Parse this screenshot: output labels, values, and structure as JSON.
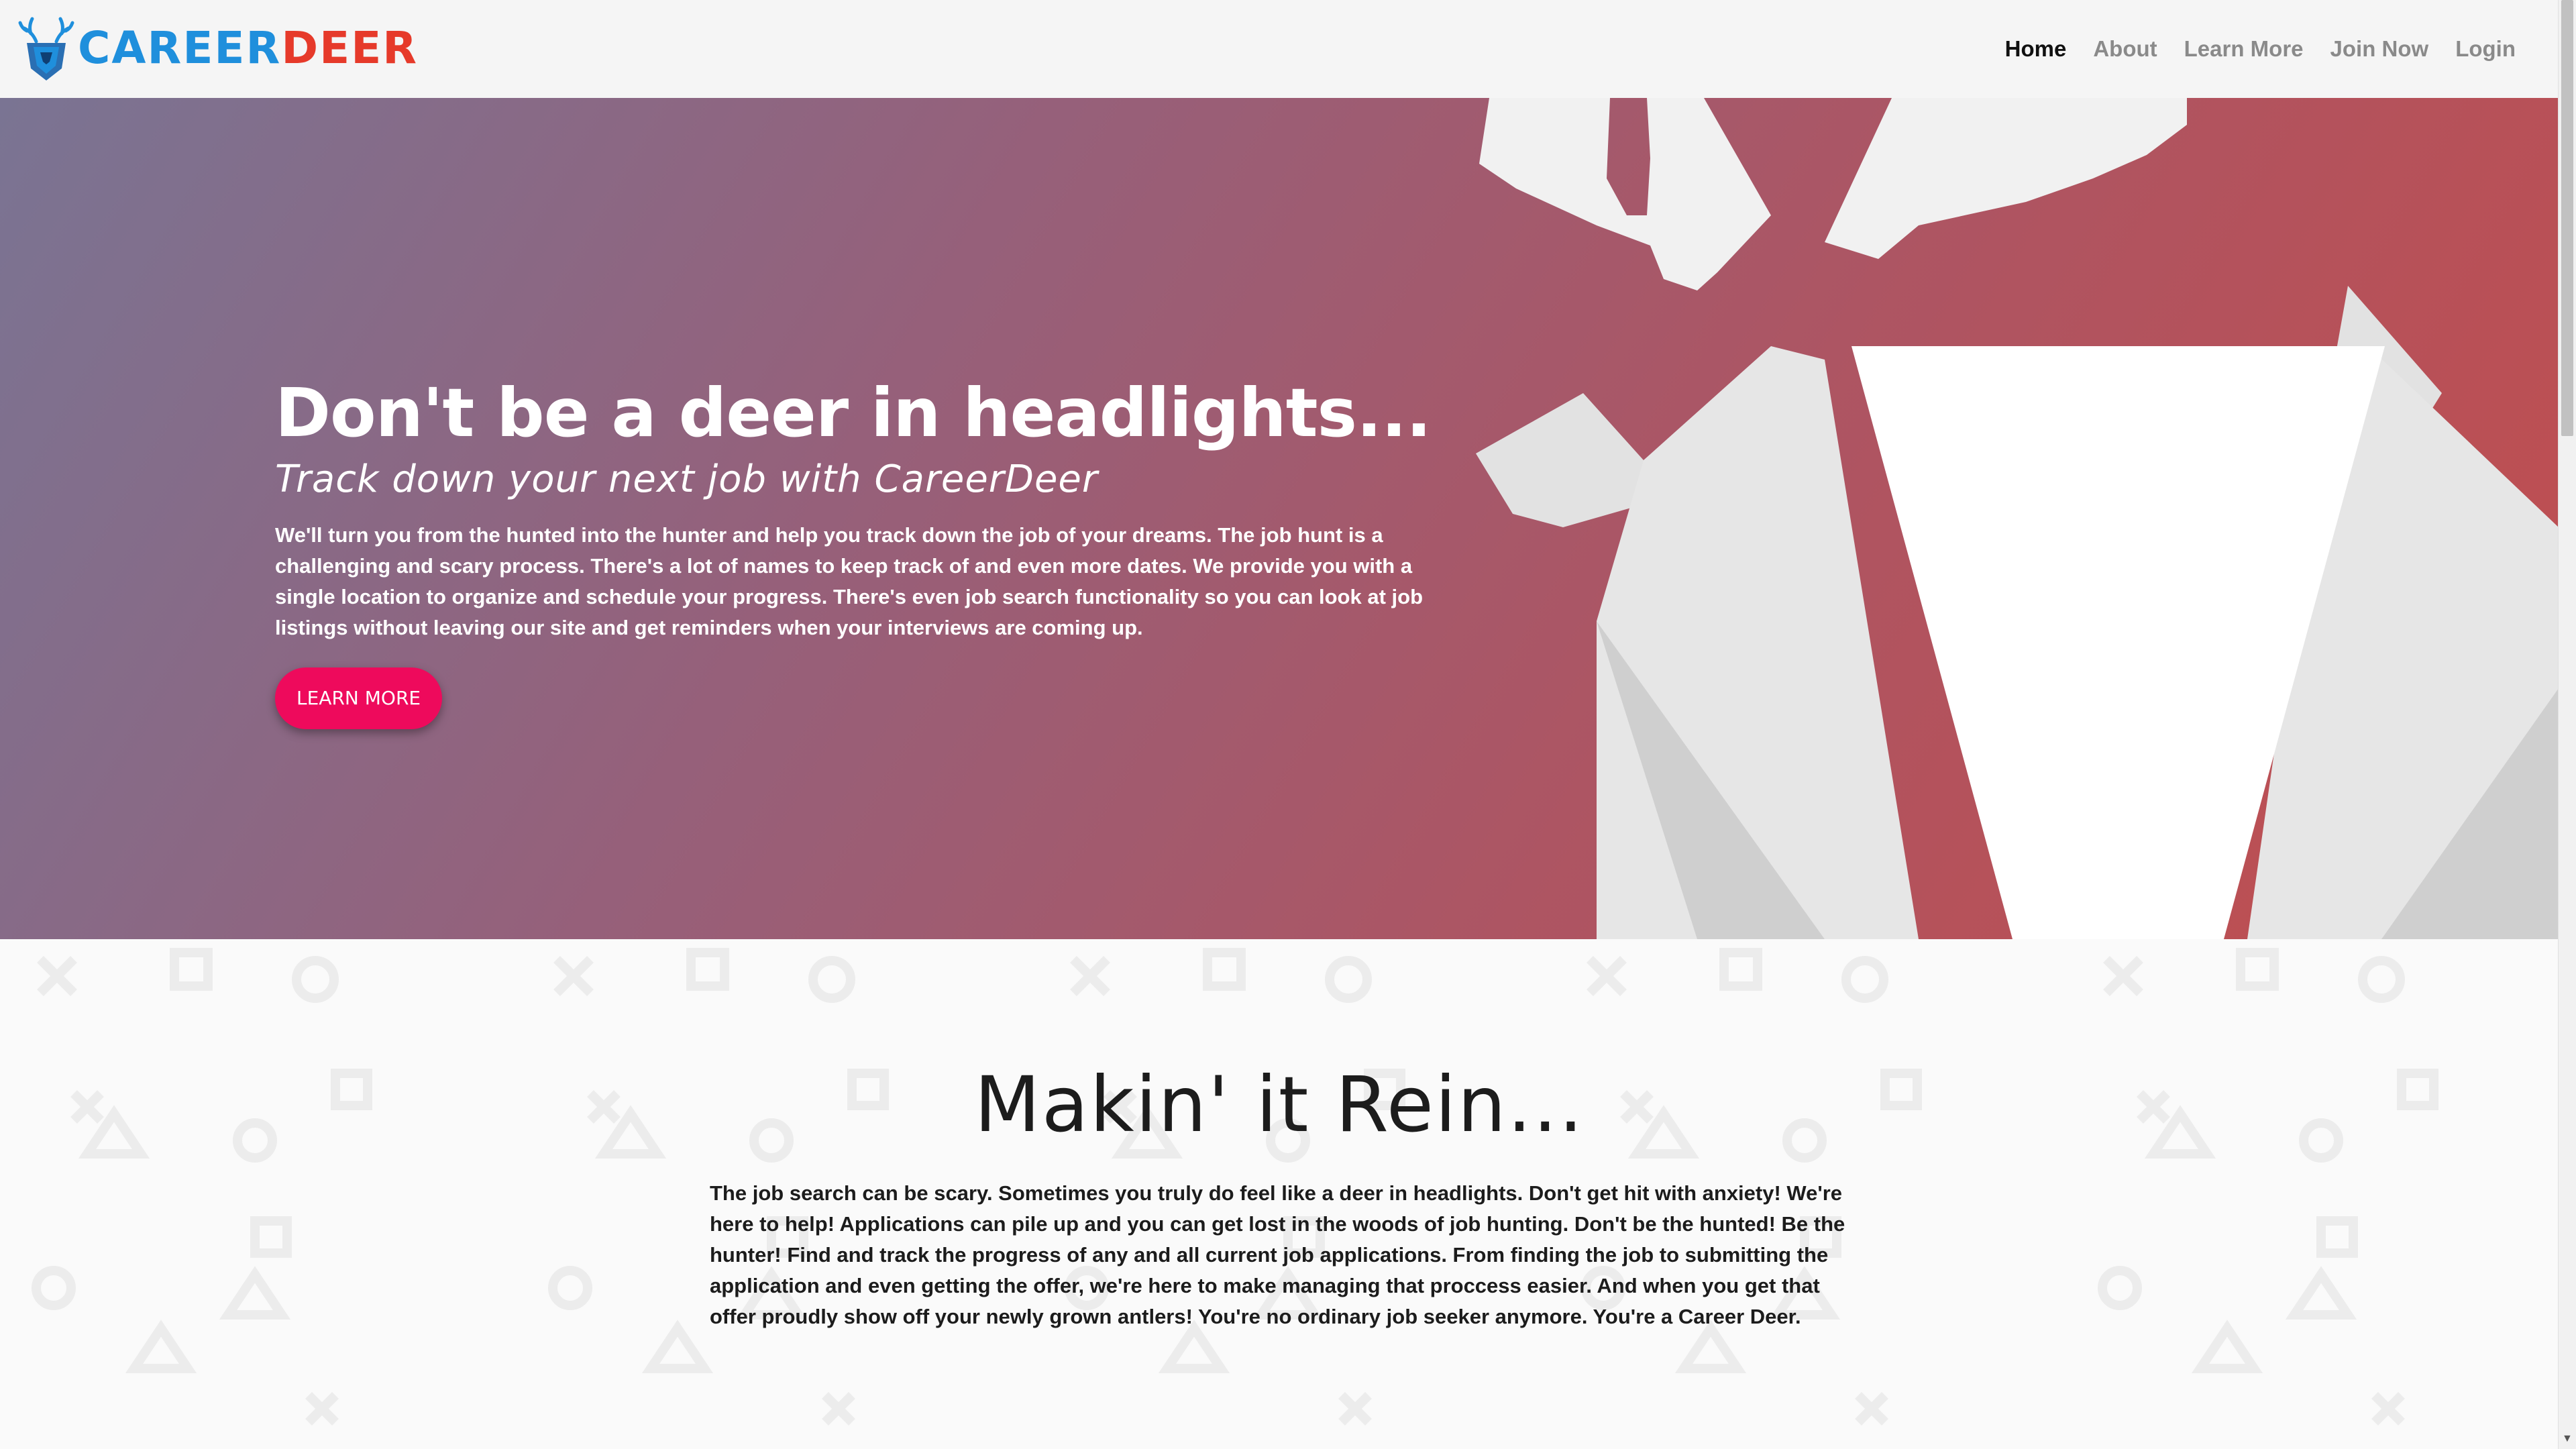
{
  "brand": {
    "part1": "CAREER",
    "part2": "DEER",
    "logo_icon": "deer-shield-icon",
    "colors": {
      "blue": "#1f8fdc",
      "red": "#e63a2a"
    }
  },
  "nav": {
    "items": [
      {
        "label": "Home",
        "active": true
      },
      {
        "label": "About",
        "active": false
      },
      {
        "label": "Learn More",
        "active": false
      },
      {
        "label": "Join Now",
        "active": false
      },
      {
        "label": "Login",
        "active": false
      }
    ]
  },
  "hero": {
    "title": "Don't be a deer in headlights...",
    "subtitle": "Track down your next job with CareerDeer",
    "body": "We'll turn you from the hunted into the hunter and help you track down the job of your dreams. The job hunt is a challenging and scary process. There's a lot of names to keep track of and even more dates. We provide you with a single location to organize and schedule your progress. There's even job search functionality so you can look at job listings without leaving our site and get reminders when your interviews are coming up.",
    "button_label": "LEARN MORE",
    "button_color": "#ee0a5c"
  },
  "about": {
    "title": "Makin' it Rein...",
    "body": "The job search can be scary. Sometimes you truly do feel like a deer in headlights. Don't get hit with anxiety! We're here to help! Applications can pile up and you can get lost in the woods of job hunting. Don't be the hunted! Be the hunter! Find and track the progress of any and all current job applications. From finding the job to submitting the application and even getting the offer, we're here to make managing that proccess easier. And when you get that offer proudly show off your newly grown antlers! You're no ordinary job seeker anymore. You're a Career Deer."
  }
}
